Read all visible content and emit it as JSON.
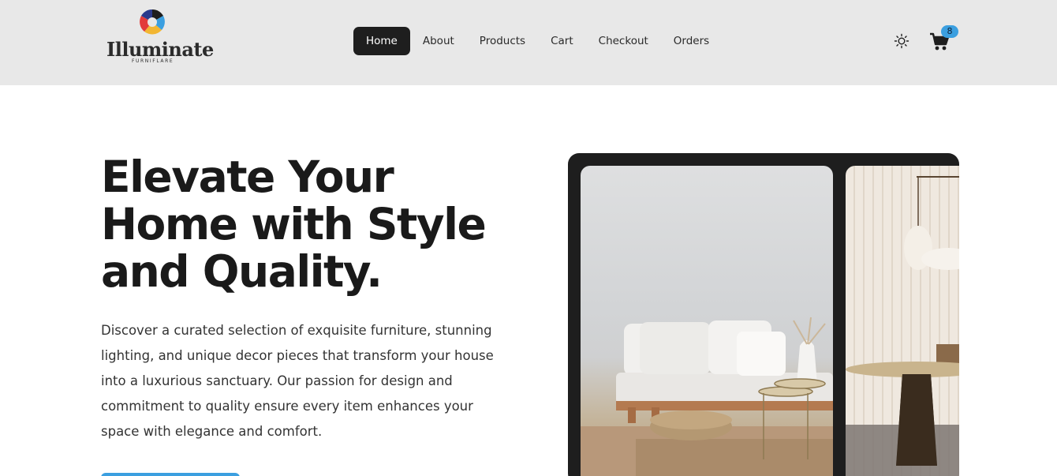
{
  "brand": {
    "name": "Illuminate",
    "tagline": "FURNIFLARE"
  },
  "nav": {
    "items": [
      {
        "label": "Home",
        "active": true
      },
      {
        "label": "About"
      },
      {
        "label": "Products"
      },
      {
        "label": "Cart"
      },
      {
        "label": "Checkout"
      },
      {
        "label": "Orders"
      }
    ]
  },
  "header": {
    "cart_count": "8",
    "theme_icon": "sun-icon",
    "cart_icon": "cart-icon"
  },
  "hero": {
    "title": "Elevate Your Home with Style and Quality.",
    "description": "Discover a curated selection of exquisite furniture, stunning lighting, and unique decor pieces that transform your house into a luxurious sanctuary. Our passion for design and commitment to quality ensure every item enhances your space with elegance and comfort."
  },
  "colors": {
    "header_bg": "#e8e8e8",
    "nav_active_bg": "#1e1e1e",
    "accent": "#3b9fe0",
    "carousel_bg": "#1e1e1e"
  }
}
